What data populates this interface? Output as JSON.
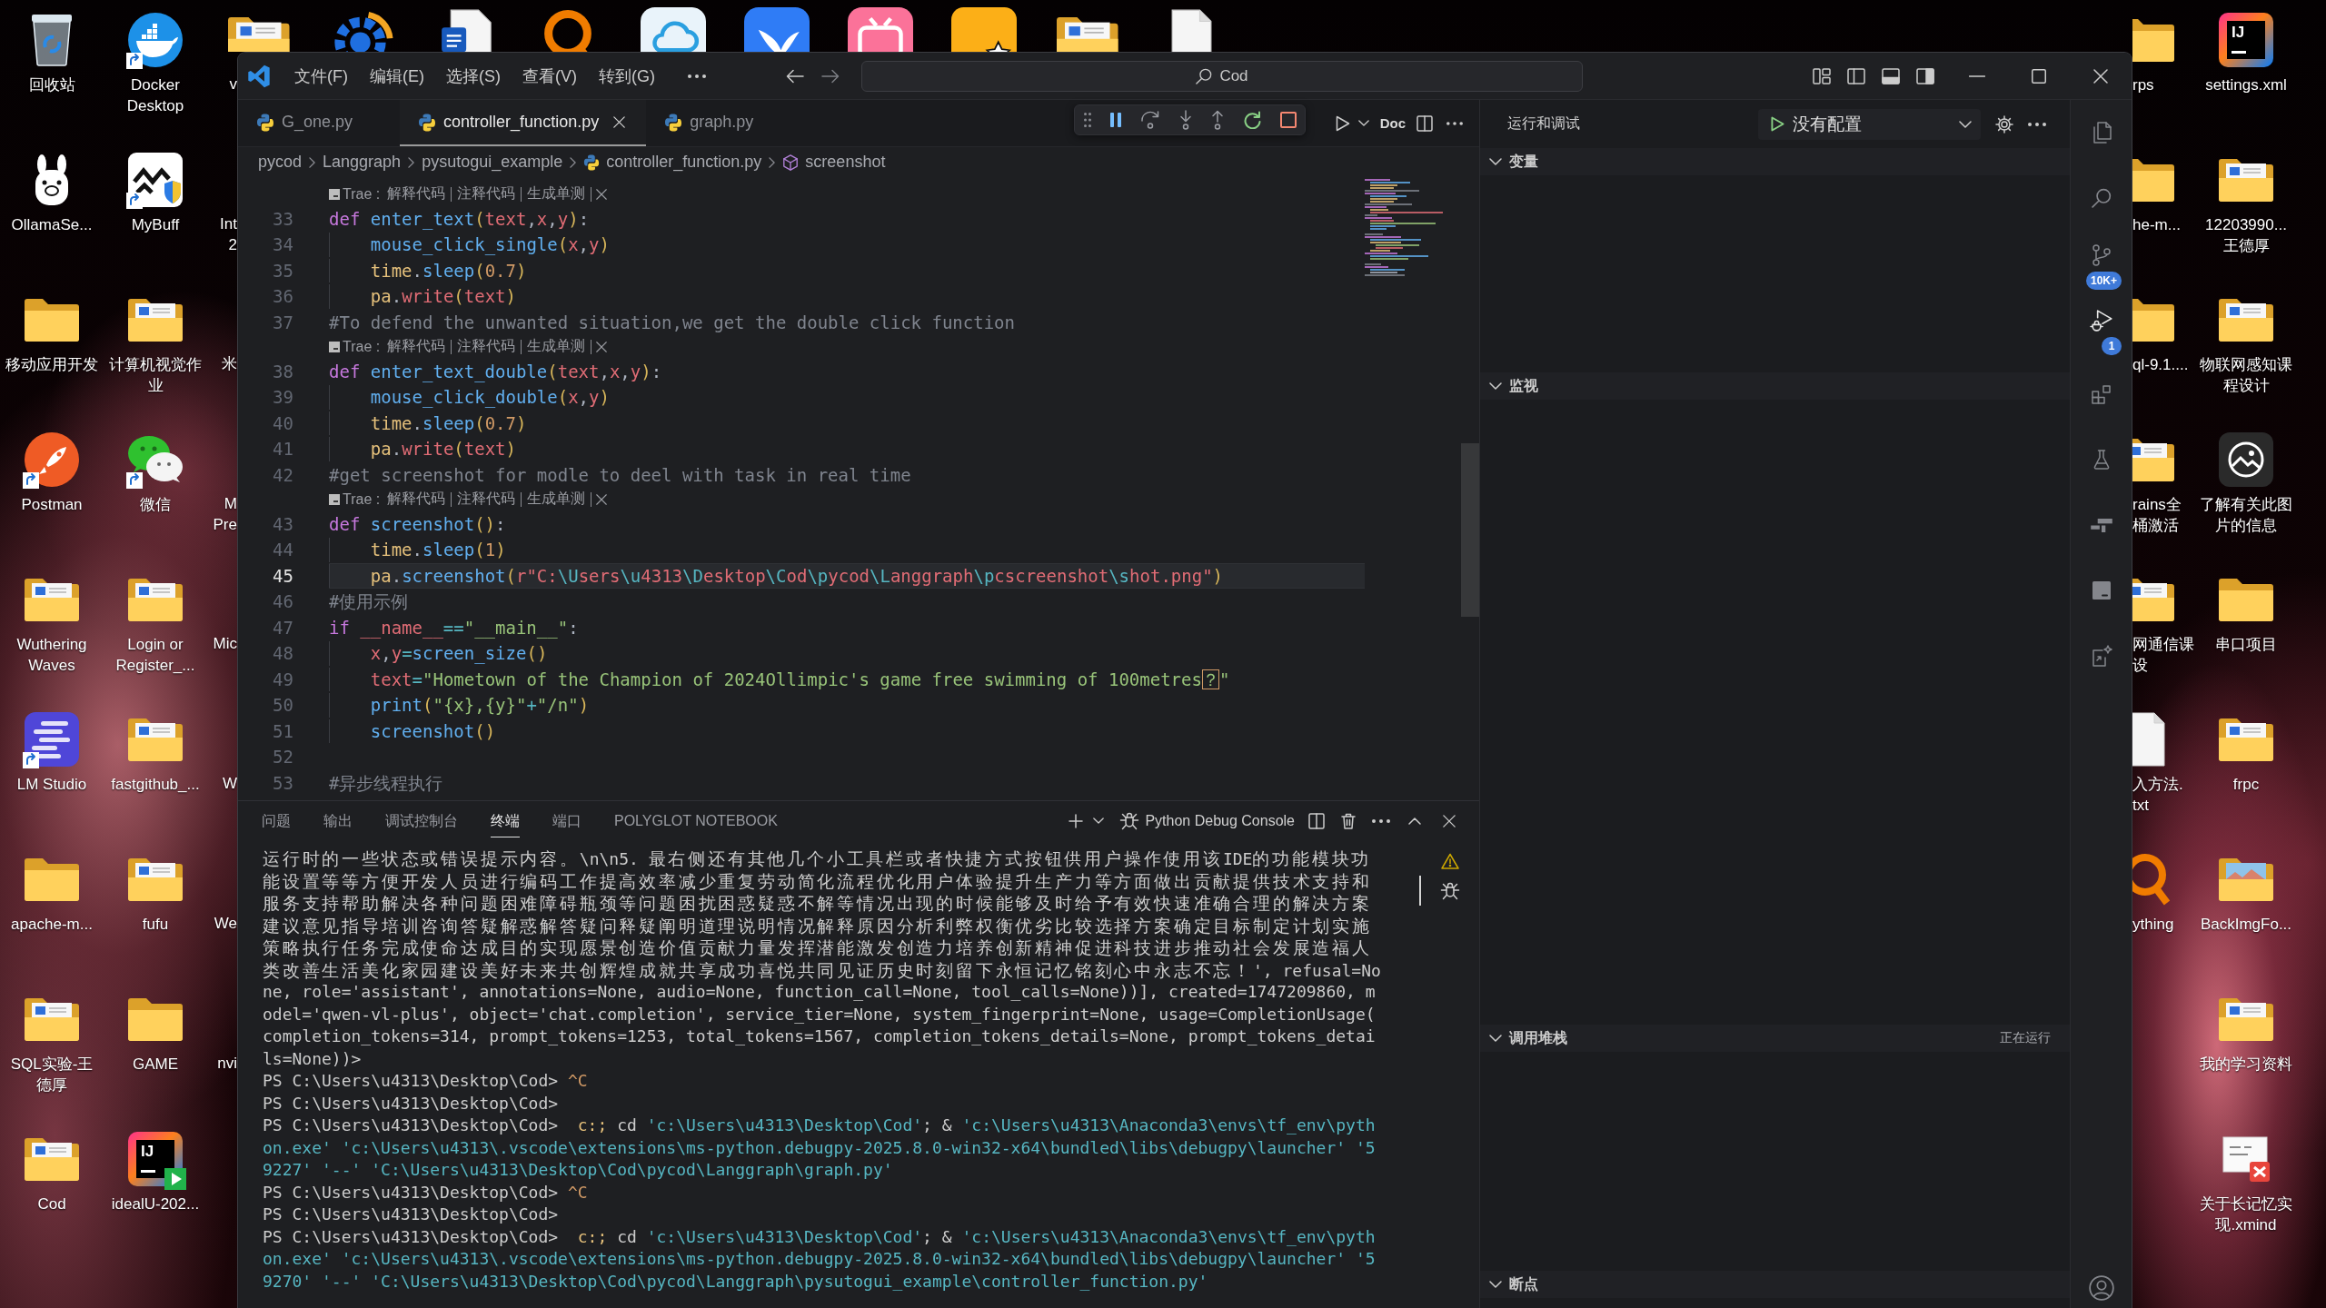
{
  "desktop": {
    "left_icons": [
      {
        "kind": "recycle",
        "label": "回收站",
        "shortcut": false
      },
      {
        "kind": "llama",
        "label": "OllamaSe...",
        "shortcut": false
      },
      {
        "kind": "folder",
        "label": "移动应用开发",
        "shortcut": false
      },
      {
        "kind": "rocket",
        "label": "Postman",
        "shortcut": true
      },
      {
        "kind": "folder-doc",
        "label": "Wuthering Waves",
        "shortcut": false
      },
      {
        "kind": "bars",
        "label": "LM Studio",
        "shortcut": true
      },
      {
        "kind": "folder",
        "label": "apache-m...",
        "shortcut": false
      },
      {
        "kind": "folder-doc",
        "label": "SQL实验-王德厚",
        "shortcut": false
      },
      {
        "kind": "folder-doc",
        "label": "Cod",
        "shortcut": false
      },
      {
        "kind": "whale",
        "label": "Docker Desktop",
        "shortcut": true
      },
      {
        "kind": "shield",
        "label": "MyBuff",
        "shortcut": true
      },
      {
        "kind": "folder-doc",
        "label": "计算机视觉作业",
        "shortcut": false
      },
      {
        "kind": "chat",
        "label": "微信",
        "shortcut": true
      },
      {
        "kind": "folder-doc",
        "label": "Login or Register_...",
        "shortcut": false
      },
      {
        "kind": "folder-doc",
        "label": "fastgithub_...",
        "shortcut": false
      },
      {
        "kind": "folder-doc",
        "label": "fufu",
        "shortcut": false
      },
      {
        "kind": "folder",
        "label": "GAME",
        "shortcut": false
      },
      {
        "kind": "ide-run",
        "label": "idealU-202...",
        "logo": "IJ",
        "shortcut": false
      }
    ],
    "left_partial_column": [
      {
        "lines": [
          "v"
        ]
      },
      {
        "lines": [
          "Int",
          "2"
        ]
      },
      {
        "lines": [
          "米"
        ]
      },
      {
        "lines": [
          "M",
          "Pre"
        ]
      },
      {
        "lines": [
          "Mic"
        ]
      },
      {
        "lines": [
          "W"
        ]
      },
      {
        "lines": [
          "We"
        ]
      },
      {
        "lines": [
          "nvi"
        ]
      }
    ],
    "right_partial_column": [
      {
        "kind": "folder",
        "lines": [
          "rps"
        ]
      },
      {
        "kind": "folder",
        "lines": [
          "he-m..."
        ]
      },
      {
        "kind": "folder",
        "lines": [
          "ql-9.1...."
        ]
      },
      {
        "kind": "folder-doc",
        "lines": [
          "rains全",
          "桶激活"
        ]
      },
      {
        "kind": "folder-doc",
        "lines": [
          "网通信课",
          "设"
        ]
      },
      {
        "kind": "file",
        "lines": [
          "入方法.",
          "txt"
        ]
      },
      {
        "kind": "ring",
        "lines": [
          "ything"
        ]
      }
    ],
    "right_icons": [
      {
        "kind": "ide",
        "label": "settings.xml",
        "logo": "IJ",
        "shortcut": false
      },
      {
        "kind": "folder-doc",
        "label": "12203990... 王德厚",
        "shortcut": false
      },
      {
        "kind": "folder-doc",
        "label": "物联网感知课程设计",
        "shortcut": false
      },
      {
        "kind": "info",
        "label": "了解有关此图片的信息",
        "shortcut": false
      },
      {
        "kind": "folder",
        "label": "串口项目",
        "shortcut": false
      },
      {
        "kind": "folder-doc",
        "label": "frpc",
        "shortcut": false
      },
      {
        "kind": "folder-photo",
        "label": "BackImgFo...",
        "shortcut": false
      },
      {
        "kind": "folder-doc",
        "label": "我的学习资料",
        "shortcut": false
      },
      {
        "kind": "mindmap",
        "label": "关于长记忆实现.xmind",
        "shortcut": false
      }
    ]
  },
  "window": {
    "menu": [
      "文件(F)",
      "编辑(E)",
      "选择(S)",
      "查看(V)",
      "转到(G)"
    ],
    "search": {
      "text": "Cod"
    }
  },
  "editor": {
    "tabs": [
      {
        "label": "G_one.py",
        "selected": false
      },
      {
        "label": "controller_function.py",
        "selected": true
      },
      {
        "label": "graph.py",
        "selected": false
      }
    ],
    "doc_button": "Doc",
    "breadcrumb": [
      {
        "kind": "folder",
        "label": "pycod"
      },
      {
        "kind": "folder",
        "label": "Langgraph"
      },
      {
        "kind": "folder",
        "label": "pysutogui_example"
      },
      {
        "kind": "file",
        "label": "controller_function.py"
      },
      {
        "kind": "symbol",
        "label": "screenshot"
      }
    ],
    "lines": [
      {
        "kind": "codelens",
        "source": "Trae :",
        "actions": [
          "解释代码",
          "注释代码",
          "生成单测"
        ]
      },
      {
        "kind": "code",
        "number": "33",
        "current": false,
        "indented": false,
        "tokens": [
          {
            "text": "def ",
            "kind": "keyword"
          },
          {
            "text": "enter_text",
            "kind": "function"
          },
          {
            "text": "(",
            "kind": "bracket"
          },
          {
            "text": "text",
            "kind": "variable"
          },
          {
            "text": ",",
            "kind": "punctuation"
          },
          {
            "text": "x",
            "kind": "variable"
          },
          {
            "text": ",",
            "kind": "punctuation"
          },
          {
            "text": "y",
            "kind": "variable"
          },
          {
            "text": ")",
            "kind": "bracket"
          },
          {
            "text": ":",
            "kind": "punctuation"
          }
        ]
      },
      {
        "kind": "code",
        "number": "34",
        "current": false,
        "indented": true,
        "tokens": [
          {
            "text": "mouse_click_single",
            "kind": "function"
          },
          {
            "text": "(",
            "kind": "bracket"
          },
          {
            "text": "x",
            "kind": "variable"
          },
          {
            "text": ",",
            "kind": "punctuation"
          },
          {
            "text": "y",
            "kind": "variable"
          },
          {
            "text": ")",
            "kind": "bracket"
          }
        ]
      },
      {
        "kind": "code",
        "number": "35",
        "current": false,
        "indented": true,
        "tokens": [
          {
            "text": "time",
            "kind": "module"
          },
          {
            "text": ".",
            "kind": "punctuation"
          },
          {
            "text": "sleep",
            "kind": "function"
          },
          {
            "text": "(",
            "kind": "bracket"
          },
          {
            "text": "0.7",
            "kind": "number"
          },
          {
            "text": ")",
            "kind": "bracket"
          }
        ]
      },
      {
        "kind": "code",
        "number": "36",
        "current": false,
        "indented": true,
        "tokens": [
          {
            "text": "pa",
            "kind": "module"
          },
          {
            "text": ".",
            "kind": "punctuation"
          },
          {
            "text": "write",
            "kind": "variable"
          },
          {
            "text": "(",
            "kind": "bracket"
          },
          {
            "text": "text",
            "kind": "variable"
          },
          {
            "text": ")",
            "kind": "bracket"
          }
        ]
      },
      {
        "kind": "code",
        "number": "37",
        "current": false,
        "indented": false,
        "tokens": [
          {
            "text": "#To defend the unwanted situation,we get the double click function",
            "kind": "comment"
          }
        ]
      },
      {
        "kind": "codelens",
        "source": "Trae :",
        "actions": [
          "解释代码",
          "注释代码",
          "生成单测"
        ]
      },
      {
        "kind": "code",
        "number": "38",
        "current": false,
        "indented": false,
        "tokens": [
          {
            "text": "def ",
            "kind": "keyword"
          },
          {
            "text": "enter_text_double",
            "kind": "function"
          },
          {
            "text": "(",
            "kind": "bracket"
          },
          {
            "text": "text",
            "kind": "variable"
          },
          {
            "text": ",",
            "kind": "punctuation"
          },
          {
            "text": "x",
            "kind": "variable"
          },
          {
            "text": ",",
            "kind": "punctuation"
          },
          {
            "text": "y",
            "kind": "variable"
          },
          {
            "text": ")",
            "kind": "bracket"
          },
          {
            "text": ":",
            "kind": "punctuation"
          }
        ]
      },
      {
        "kind": "code",
        "number": "39",
        "current": false,
        "indented": true,
        "tokens": [
          {
            "text": "mouse_click_double",
            "kind": "function"
          },
          {
            "text": "(",
            "kind": "bracket"
          },
          {
            "text": "x",
            "kind": "variable"
          },
          {
            "text": ",",
            "kind": "punctuation"
          },
          {
            "text": "y",
            "kind": "variable"
          },
          {
            "text": ")",
            "kind": "bracket"
          }
        ]
      },
      {
        "kind": "code",
        "number": "40",
        "current": false,
        "indented": true,
        "tokens": [
          {
            "text": "time",
            "kind": "module"
          },
          {
            "text": ".",
            "kind": "punctuation"
          },
          {
            "text": "sleep",
            "kind": "function"
          },
          {
            "text": "(",
            "kind": "bracket"
          },
          {
            "text": "0.7",
            "kind": "number"
          },
          {
            "text": ")",
            "kind": "bracket"
          }
        ]
      },
      {
        "kind": "code",
        "number": "41",
        "current": false,
        "indented": true,
        "tokens": [
          {
            "text": "pa",
            "kind": "module"
          },
          {
            "text": ".",
            "kind": "punctuation"
          },
          {
            "text": "write",
            "kind": "variable"
          },
          {
            "text": "(",
            "kind": "bracket"
          },
          {
            "text": "text",
            "kind": "variable"
          },
          {
            "text": ")",
            "kind": "bracket"
          }
        ]
      },
      {
        "kind": "code",
        "number": "42",
        "current": false,
        "indented": false,
        "tokens": [
          {
            "text": "#get screenshot for modle to deel with task in real time",
            "kind": "comment"
          }
        ]
      },
      {
        "kind": "codelens",
        "source": "Trae :",
        "actions": [
          "解释代码",
          "注释代码",
          "生成单测"
        ]
      },
      {
        "kind": "code",
        "number": "43",
        "current": false,
        "indented": false,
        "tokens": [
          {
            "text": "def ",
            "kind": "keyword"
          },
          {
            "text": "screenshot",
            "kind": "function"
          },
          {
            "text": "()",
            "kind": "bracket"
          },
          {
            "text": ":",
            "kind": "punctuation"
          }
        ]
      },
      {
        "kind": "code",
        "number": "44",
        "current": false,
        "indented": true,
        "tokens": [
          {
            "text": "time",
            "kind": "module"
          },
          {
            "text": ".",
            "kind": "punctuation"
          },
          {
            "text": "sleep",
            "kind": "function"
          },
          {
            "text": "(",
            "kind": "bracket"
          },
          {
            "text": "1",
            "kind": "number"
          },
          {
            "text": ")",
            "kind": "bracket"
          }
        ]
      },
      {
        "kind": "code",
        "number": "45",
        "current": true,
        "indented": true,
        "tokens": [
          {
            "text": "pa",
            "kind": "module"
          },
          {
            "text": ".",
            "kind": "punctuation"
          },
          {
            "text": "screenshot",
            "kind": "function"
          },
          {
            "text": "(",
            "kind": "bracket"
          },
          {
            "text": "r\"C:",
            "kind": "raw"
          },
          {
            "text": "\\U",
            "kind": "escape"
          },
          {
            "text": "sers",
            "kind": "raw"
          },
          {
            "text": "\\u",
            "kind": "escape"
          },
          {
            "text": "4313",
            "kind": "raw"
          },
          {
            "text": "\\D",
            "kind": "escape"
          },
          {
            "text": "esktop",
            "kind": "raw"
          },
          {
            "text": "\\C",
            "kind": "escape"
          },
          {
            "text": "od",
            "kind": "raw"
          },
          {
            "text": "\\p",
            "kind": "escape"
          },
          {
            "text": "ycod",
            "kind": "raw"
          },
          {
            "text": "\\L",
            "kind": "escape"
          },
          {
            "text": "anggraph",
            "kind": "raw"
          },
          {
            "text": "\\p",
            "kind": "escape"
          },
          {
            "text": "cscreenshot",
            "kind": "raw"
          },
          {
            "text": "\\s",
            "kind": "escape"
          },
          {
            "text": "hot.png\"",
            "kind": "raw"
          },
          {
            "text": ")",
            "kind": "bracket"
          }
        ]
      },
      {
        "kind": "code",
        "number": "46",
        "current": false,
        "indented": false,
        "tokens": [
          {
            "text": "#使用示例",
            "kind": "comment"
          }
        ]
      },
      {
        "kind": "code",
        "number": "47",
        "current": false,
        "indented": false,
        "tokens": [
          {
            "text": "if ",
            "kind": "keyword"
          },
          {
            "text": "__name__",
            "kind": "variable"
          },
          {
            "text": "==",
            "kind": "operator"
          },
          {
            "text": "\"__main__\"",
            "kind": "string"
          },
          {
            "text": ":",
            "kind": "punctuation"
          }
        ]
      },
      {
        "kind": "code",
        "number": "48",
        "current": false,
        "indented": true,
        "tokens": [
          {
            "text": "x",
            "kind": "variable"
          },
          {
            "text": ",",
            "kind": "punctuation"
          },
          {
            "text": "y",
            "kind": "variable"
          },
          {
            "text": "=",
            "kind": "operator"
          },
          {
            "text": "screen_size",
            "kind": "function"
          },
          {
            "text": "()",
            "kind": "bracket"
          }
        ]
      },
      {
        "kind": "code",
        "number": "49",
        "current": false,
        "indented": true,
        "tokens": [
          {
            "text": "text",
            "kind": "variable"
          },
          {
            "text": "=",
            "kind": "operator"
          },
          {
            "text": "\"Hometown of the Champion of 2024Ollimpic's game free swimming of 100metres",
            "kind": "string"
          },
          {
            "text": "？",
            "kind": "ambiguous"
          },
          {
            "text": "\"",
            "kind": "string"
          }
        ]
      },
      {
        "kind": "code",
        "number": "50",
        "current": false,
        "indented": true,
        "tokens": [
          {
            "text": "print",
            "kind": "function"
          },
          {
            "text": "(",
            "kind": "bracket"
          },
          {
            "text": "\"{x},{y}\"",
            "kind": "string"
          },
          {
            "text": "+",
            "kind": "operator"
          },
          {
            "text": "\"/n\"",
            "kind": "string"
          },
          {
            "text": ")",
            "kind": "bracket"
          }
        ]
      },
      {
        "kind": "code",
        "number": "51",
        "current": false,
        "indented": true,
        "tokens": [
          {
            "text": "screenshot",
            "kind": "function"
          },
          {
            "text": "()",
            "kind": "bracket"
          }
        ]
      },
      {
        "kind": "code",
        "number": "52",
        "current": false
      },
      {
        "kind": "code",
        "number": "53",
        "current": false,
        "indented": false,
        "tokens": [
          {
            "text": "#异步线程执行",
            "kind": "comment"
          }
        ]
      }
    ]
  },
  "panel": {
    "tabs": [
      {
        "label": "问题",
        "selected": false
      },
      {
        "label": "输出",
        "selected": false
      },
      {
        "label": "调试控制台",
        "selected": false
      },
      {
        "label": "终端",
        "selected": true
      },
      {
        "label": "端口",
        "selected": false
      },
      {
        "label": "POLYGLOT NOTEBOOK",
        "selected": false
      }
    ],
    "terminal_name": "Python Debug Console",
    "lines": [
      {
        "tokens": [
          {
            "text": "运行时的一些状态或错误提示内容。",
            "kind": "wide"
          },
          {
            "text": "\\n\\n5. ",
            "kind": "output"
          },
          {
            "text": "最右侧还有其他几个小工具栏或者快捷方式按钮供用户操作使用该",
            "kind": "wide"
          },
          {
            "text": "IDE",
            "kind": "output"
          },
          {
            "text": "的功能模块功",
            "kind": "wide"
          }
        ]
      },
      {
        "tokens": [
          {
            "text": "能设置等等方便开发人员进行编码工作提高效率减少重复劳动简化流程优化用户体验提升生产力等方面做出贡献提供技术支持和",
            "kind": "wide"
          }
        ]
      },
      {
        "tokens": [
          {
            "text": "服务支持帮助解决各种问题困难障碍瓶颈等问题困扰困惑疑惑不解等情况出现的时候能够及时给予有效快速准确合理的解决方案",
            "kind": "wide"
          }
        ]
      },
      {
        "tokens": [
          {
            "text": "建议意见指导培训咨询答疑解惑解答疑问释疑阐明道理说明情况解释原因分析利弊权衡优劣比较选择方案确定目标制定计划实施",
            "kind": "wide"
          }
        ]
      },
      {
        "tokens": [
          {
            "text": "策略执行任务完成使命达成目的实现愿景创造价值贡献力量发挥潜能激发创造力培养创新精神促进科技进步推动社会发展造福人",
            "kind": "wide"
          }
        ]
      },
      {
        "tokens": [
          {
            "text": "类改善生活美化家园建设美好未来共创辉煌成就共享成功喜悦共同见证历史时刻留下永恒记忆铭刻心中永志不忘！",
            "kind": "wide"
          },
          {
            "text": "', refusal=No",
            "kind": "output"
          }
        ]
      },
      {
        "tokens": [
          {
            "text": "ne, role='assistant', annotations=None, audio=None, function_call=None, tool_calls=None))], created=1747209860, m",
            "kind": "output"
          }
        ]
      },
      {
        "tokens": [
          {
            "text": "odel='qwen-vl-plus', object='chat.completion', service_tier=None, system_fingerprint=None, usage=CompletionUsage(",
            "kind": "output"
          }
        ]
      },
      {
        "tokens": [
          {
            "text": "completion_tokens=314, prompt_tokens=1253, total_tokens=1567, completion_tokens_details=None, prompt_tokens_detai",
            "kind": "output"
          }
        ]
      },
      {
        "tokens": [
          {
            "text": "ls=None))>",
            "kind": "output"
          }
        ]
      },
      {
        "tokens": [
          {
            "text": "PS C:\\Users\\u4313\\Desktop\\Cod> ",
            "kind": "output"
          },
          {
            "text": "^C",
            "kind": "control"
          }
        ]
      },
      {
        "tokens": [
          {
            "text": "PS C:\\Users\\u4313\\Desktop\\Cod>",
            "kind": "output"
          }
        ]
      },
      {
        "tokens": [
          {
            "text": "PS C:\\Users\\u4313\\Desktop\\Cod>  ",
            "kind": "output"
          },
          {
            "text": "c:;",
            "kind": "command"
          },
          {
            "text": " cd ",
            "kind": "output"
          },
          {
            "text": "'c:\\Users\\u4313\\Desktop\\Cod'",
            "kind": "argument"
          },
          {
            "text": "; & ",
            "kind": "output"
          },
          {
            "text": "'c:\\Users\\u4313\\Anaconda3\\envs\\tf_env\\pyth",
            "kind": "argument"
          }
        ]
      },
      {
        "tokens": [
          {
            "text": "on.exe' 'c:\\Users\\u4313\\.vscode\\extensions\\ms-python.debugpy-2025.8.0-win32-x64\\bundled\\libs\\debugpy\\launcher' '5",
            "kind": "argument"
          }
        ]
      },
      {
        "tokens": [
          {
            "text": "9227' '--' 'C:\\Users\\u4313\\Desktop\\Cod\\pycod\\Langgraph\\graph.py'",
            "kind": "argument"
          }
        ]
      },
      {
        "tokens": [
          {
            "text": "PS C:\\Users\\u4313\\Desktop\\Cod> ",
            "kind": "output"
          },
          {
            "text": "^C",
            "kind": "control"
          }
        ]
      },
      {
        "tokens": [
          {
            "text": "PS C:\\Users\\u4313\\Desktop\\Cod>",
            "kind": "output"
          }
        ]
      },
      {
        "tokens": [
          {
            "text": "PS C:\\Users\\u4313\\Desktop\\Cod>  ",
            "kind": "output"
          },
          {
            "text": "c:;",
            "kind": "command"
          },
          {
            "text": " cd ",
            "kind": "output"
          },
          {
            "text": "'c:\\Users\\u4313\\Desktop\\Cod'",
            "kind": "argument"
          },
          {
            "text": "; & ",
            "kind": "output"
          },
          {
            "text": "'c:\\Users\\u4313\\Anaconda3\\envs\\tf_env\\pyth",
            "kind": "argument"
          }
        ]
      },
      {
        "tokens": [
          {
            "text": "on.exe' 'c:\\Users\\u4313\\.vscode\\extensions\\ms-python.debugpy-2025.8.0-win32-x64\\bundled\\libs\\debugpy\\launcher' '5",
            "kind": "argument"
          }
        ]
      },
      {
        "tokens": [
          {
            "text": "9270' '--' 'C:\\Users\\u4313\\Desktop\\Cod\\pycod\\Langgraph\\pysutogui_example\\controller_function.py'",
            "kind": "argument"
          }
        ]
      }
    ]
  },
  "run_debug": {
    "title": "运行和调试",
    "config": "没有配置",
    "sections": [
      {
        "title": "变量",
        "expanded": true
      },
      {
        "title": "监视",
        "expanded": true
      },
      {
        "title": "调用堆栈",
        "expanded": true,
        "status": "正在运行"
      },
      {
        "title": "断点",
        "expanded": true
      }
    ]
  },
  "activity_bar": [
    {
      "kind": "explorer",
      "selected": false
    },
    {
      "kind": "search",
      "selected": false
    },
    {
      "kind": "source-control",
      "selected": false,
      "badge": "10K+"
    },
    {
      "kind": "run-debug",
      "selected": true,
      "badge": "1"
    },
    {
      "kind": "extensions",
      "selected": false
    },
    {
      "kind": "testing",
      "selected": false
    },
    {
      "kind": "containers",
      "selected": false
    },
    {
      "kind": "output",
      "selected": false
    },
    {
      "kind": "ai-doc",
      "selected": false
    },
    {
      "kind": "account",
      "selected": false
    }
  ]
}
